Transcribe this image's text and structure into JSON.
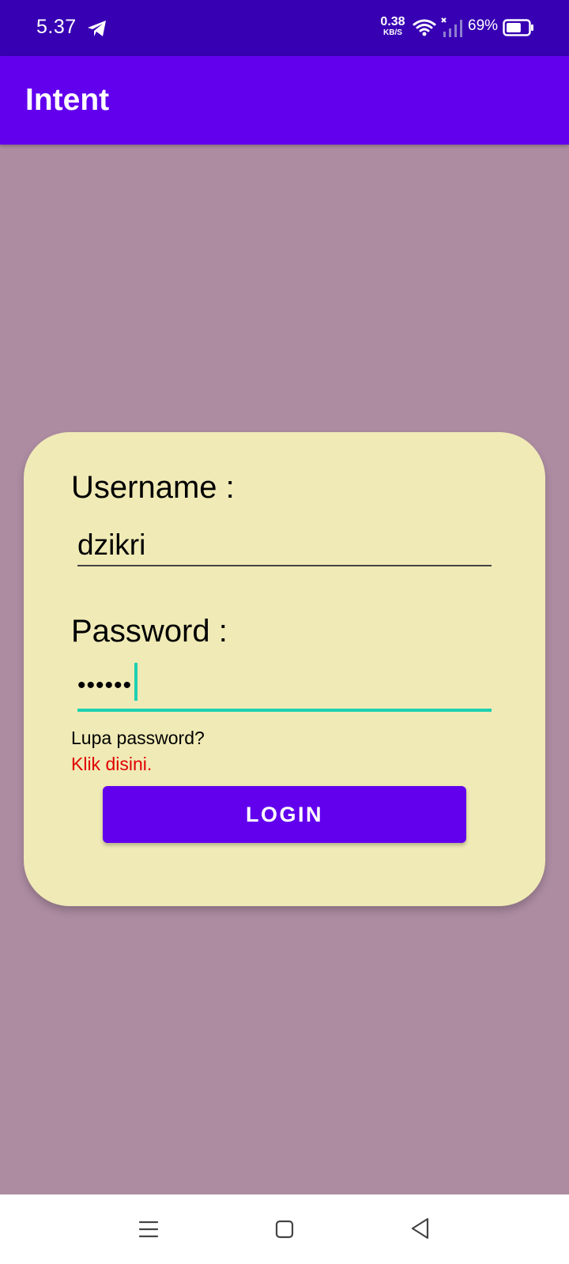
{
  "status_bar": {
    "time": "5.37",
    "net_speed_value": "0.38",
    "net_speed_unit": "KB/S",
    "battery_percent": "69%",
    "battery_level": 0.69,
    "icons": [
      "telegram-icon",
      "wifi-icon",
      "signal-icon",
      "battery-icon"
    ]
  },
  "app_bar": {
    "title": "Intent"
  },
  "login": {
    "username_label": "Username :",
    "username_value": "dzikri",
    "password_label": "Password :",
    "password_value": "••••••",
    "forgot_text": "Lupa password?",
    "forgot_link": "Klik disini.",
    "login_button": "LOGIN"
  },
  "nav_bar": {
    "icons": [
      "menu-icon",
      "home-icon",
      "back-icon"
    ]
  },
  "colors": {
    "status_bar": "#3700b3",
    "app_bar": "#6200ee",
    "background": "#ad8ca2",
    "card": "#f0eab6",
    "accent": "#1dd1b0",
    "link": "#e00000"
  }
}
